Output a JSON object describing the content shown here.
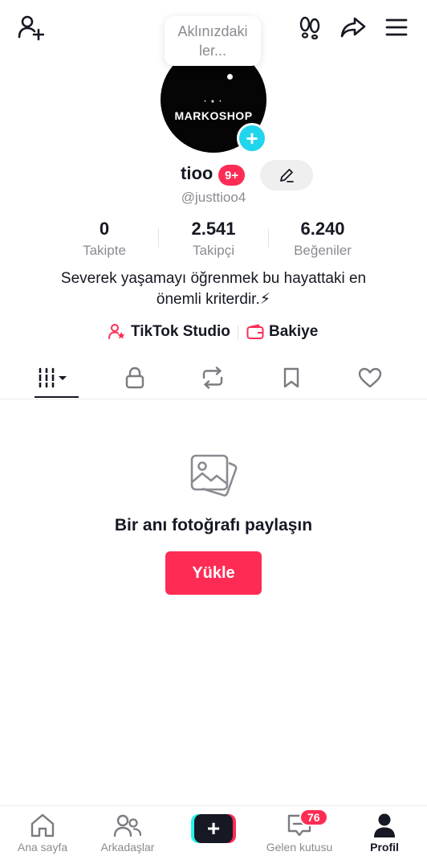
{
  "note": {
    "text": "Aklınızdaki ler..."
  },
  "profile": {
    "avatar_text": "MARKOSHOP",
    "avatar_stars": "• ★ •",
    "avatar_add": "+",
    "username": "tioo",
    "badge": "9+",
    "handle": "@justtioo4",
    "bio": "Severek yaşamayı öğrenmek bu hayattaki en önemli kriterdir.⚡"
  },
  "stats": [
    {
      "value": "0",
      "label": "Takipte"
    },
    {
      "value": "2.541",
      "label": "Takipçi"
    },
    {
      "value": "6.240",
      "label": "Beğeniler"
    }
  ],
  "links": {
    "studio": "TikTok Studio",
    "wallet": "Bakiye"
  },
  "empty_state": {
    "title": "Bir anı fotoğrafı paylaşın",
    "button": "Yükle"
  },
  "nav": {
    "home": "Ana sayfa",
    "friends": "Arkadaşlar",
    "create": "+",
    "inbox": "Gelen kutusu",
    "inbox_badge": "76",
    "profile": "Profil"
  },
  "colors": {
    "accent": "#fe2c55",
    "cyan": "#25f4ee",
    "text": "#161823",
    "muted": "#8a8b91"
  }
}
